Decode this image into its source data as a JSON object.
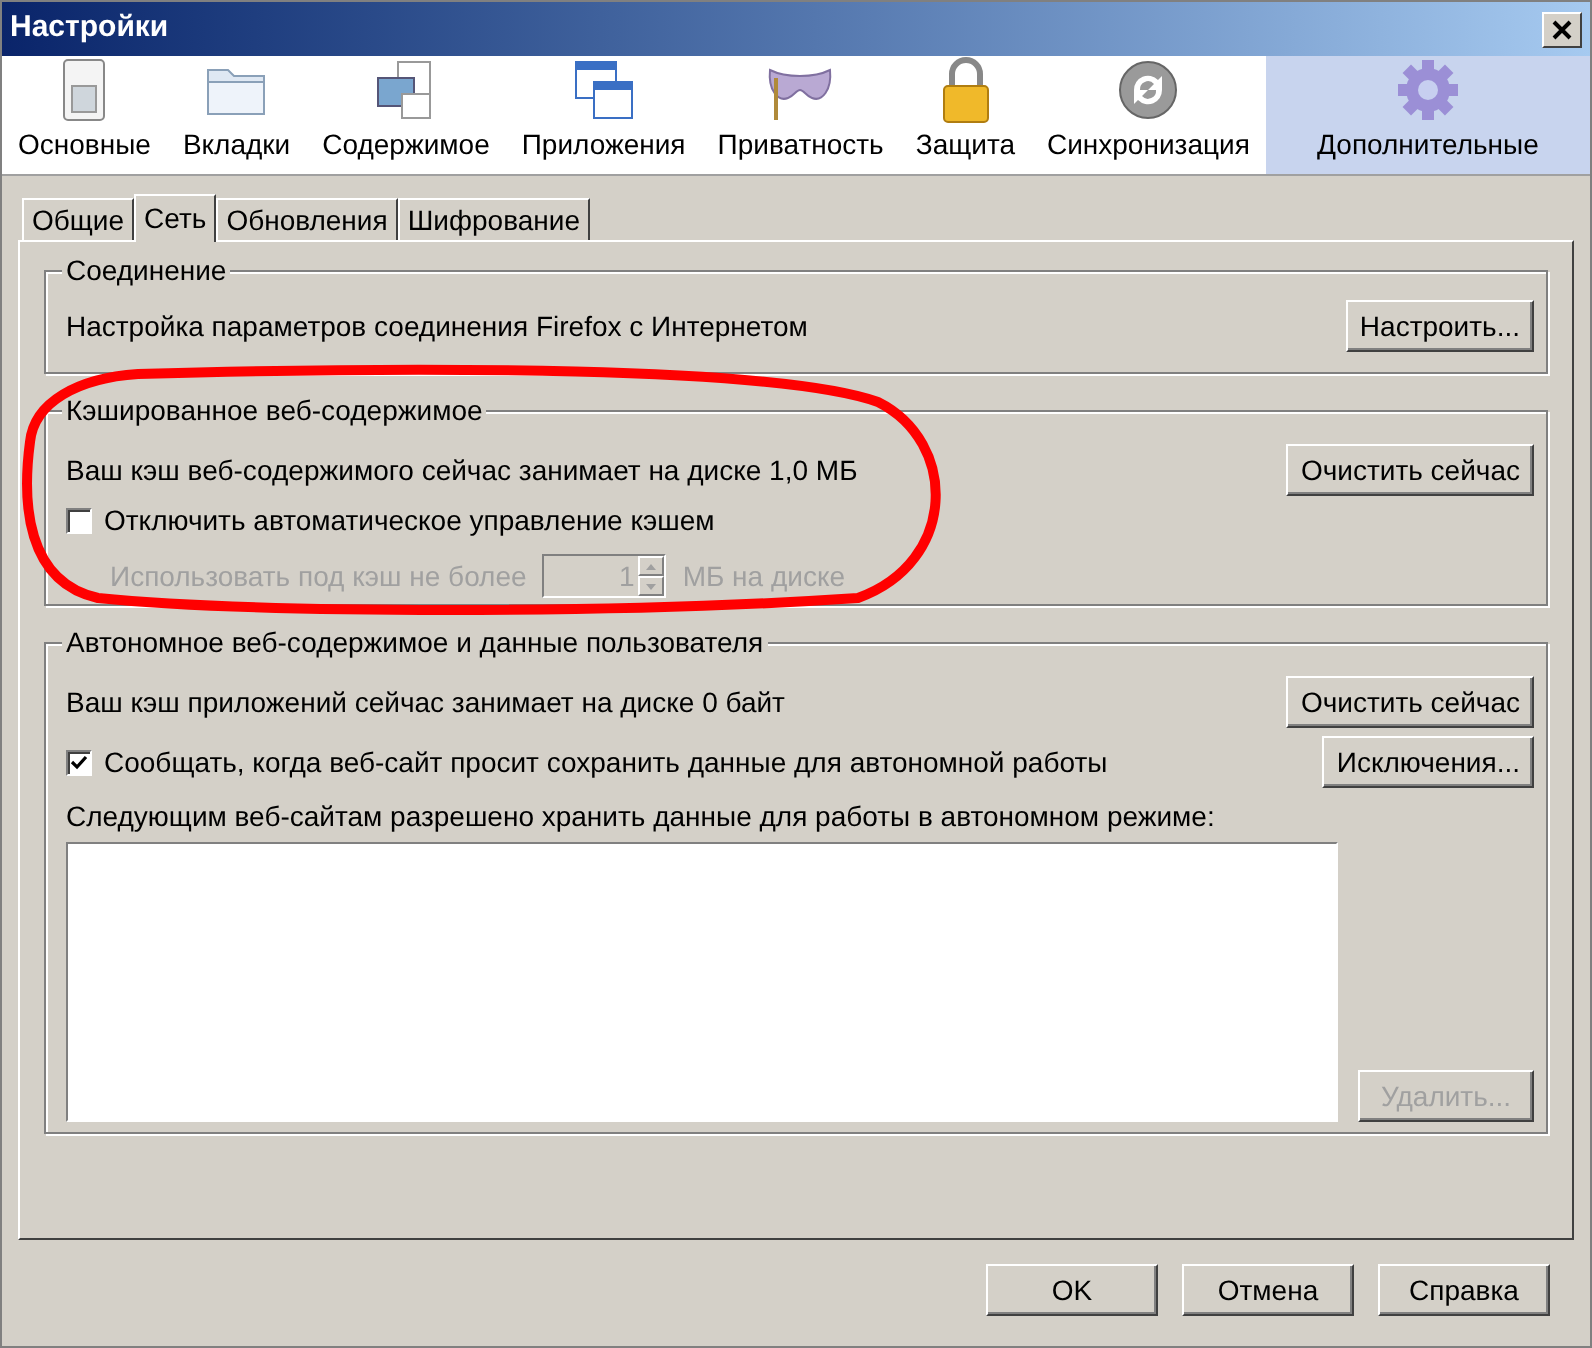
{
  "window": {
    "title": "Настройки"
  },
  "toolbar": [
    {
      "label": "Основные",
      "selected": false
    },
    {
      "label": "Вкладки",
      "selected": false
    },
    {
      "label": "Содержимое",
      "selected": false
    },
    {
      "label": "Приложения",
      "selected": false
    },
    {
      "label": "Приватность",
      "selected": false
    },
    {
      "label": "Защита",
      "selected": false
    },
    {
      "label": "Синхронизация",
      "selected": false
    },
    {
      "label": "Дополнительные",
      "selected": true
    }
  ],
  "tabs": [
    {
      "label": "Общие",
      "selected": false
    },
    {
      "label": "Сеть",
      "selected": true
    },
    {
      "label": "Обновления",
      "selected": false
    },
    {
      "label": "Шифрование",
      "selected": false
    }
  ],
  "connection": {
    "title": "Соединение",
    "text": "Настройка параметров соединения Firefox с Интернетом",
    "button": "Настроить..."
  },
  "cache": {
    "title": "Кэшированное веб-содержимое",
    "usage": "Ваш кэш веб-содержимого сейчас занимает на диске 1,0 МБ",
    "clear_button": "Очистить сейчас",
    "override": {
      "label": "Отключить автоматическое управление кэшем",
      "checked": false
    },
    "limit": {
      "label": "Использовать под кэш не более",
      "value": "1",
      "unit": "МБ на диске",
      "disabled": true
    }
  },
  "offline": {
    "title": "Автономное веб-содержимое и данные пользователя",
    "usage": "Ваш кэш приложений сейчас занимает на диске 0 байт",
    "clear_button": "Очистить сейчас",
    "notify": {
      "label": "Сообщать, когда веб-сайт просит сохранить данные для автономной работы",
      "checked": true
    },
    "exceptions_button": "Исключения...",
    "list_label": "Следующим веб-сайтам разрешено хранить данные для работы в автономном режиме:",
    "remove_button": {
      "label": "Удалить...",
      "disabled": true
    }
  },
  "buttons": [
    "OK",
    "Отмена",
    "Справка"
  ]
}
